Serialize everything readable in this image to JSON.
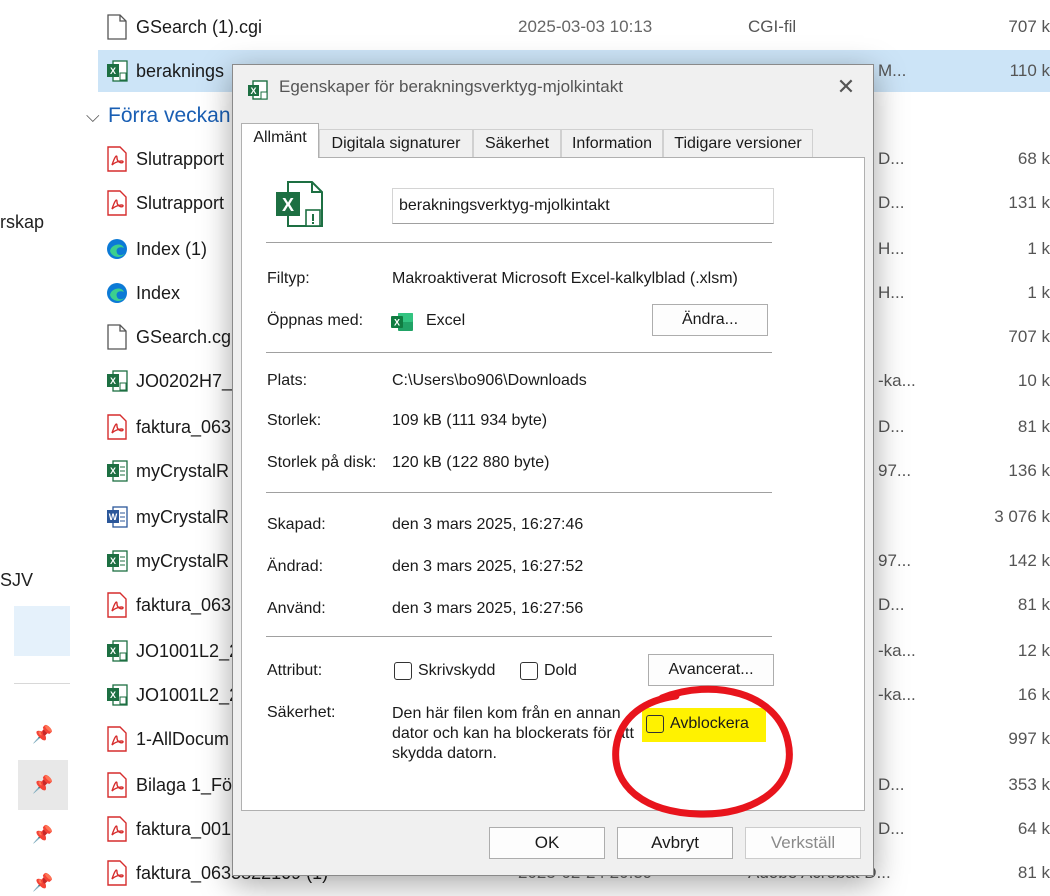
{
  "nav": {
    "label_1": "rskap",
    "label_2": "SJV"
  },
  "files": {
    "group_title": "Förra veckan",
    "rows": [
      {
        "name": "GSearch (1).cgi",
        "date": "2025-03-03 10:13",
        "type": "CGI-fil",
        "size": "707 k",
        "icon": "generic-file-icon"
      },
      {
        "name": "beraknings",
        "type": "M...",
        "size": "110 k",
        "icon": "excel-macro-icon"
      },
      {
        "name": "Slutrapport",
        "type": "D...",
        "size": "68 k",
        "icon": "pdf-icon"
      },
      {
        "name": "Slutrapport",
        "type": "D...",
        "size": "131 k",
        "icon": "pdf-icon"
      },
      {
        "name": "Index (1)",
        "type": "H...",
        "size": "1 k",
        "icon": "edge-icon"
      },
      {
        "name": "Index",
        "type": "H...",
        "size": "1 k",
        "icon": "edge-icon"
      },
      {
        "name": "GSearch.cg",
        "type": "",
        "size": "707 k",
        "icon": "generic-file-icon"
      },
      {
        "name": "JO0202H7_2",
        "type": "-ka...",
        "size": "10 k",
        "icon": "excel-macro-icon"
      },
      {
        "name": "faktura_063",
        "type": "D...",
        "size": "81 k",
        "icon": "pdf-icon"
      },
      {
        "name": "myCrystalR",
        "type": "97...",
        "size": "136 k",
        "icon": "excel-green-icon"
      },
      {
        "name": "myCrystalR",
        "type": "",
        "size": "3 076 k",
        "icon": "word-icon"
      },
      {
        "name": "myCrystalR",
        "type": "97...",
        "size": "142 k",
        "icon": "excel-green-icon"
      },
      {
        "name": "faktura_063",
        "type": "D...",
        "size": "81 k",
        "icon": "pdf-icon"
      },
      {
        "name": "JO1001L2_2",
        "type": "-ka...",
        "size": "12 k",
        "icon": "excel-macro-icon"
      },
      {
        "name": "JO1001L2_2",
        "type": "-ka...",
        "size": "16 k",
        "icon": "excel-macro-icon"
      },
      {
        "name": "1-AllDocum",
        "type": "",
        "size": "997 k",
        "icon": "pdf-icon"
      },
      {
        "name": "Bilaga 1_Fö",
        "type": "D...",
        "size": "353 k",
        "icon": "pdf-icon"
      },
      {
        "name": "faktura_001",
        "type": "D...",
        "size": "64 k",
        "icon": "pdf-icon"
      },
      {
        "name": "faktura_0635822109 (1)",
        "date": "2025-02-24 20:39",
        "type": "Adobe Acrobat D...",
        "size": "81 k",
        "icon": "pdf-icon"
      }
    ]
  },
  "dialog": {
    "title": "Egenskaper för berakningsverktyg-mjolkintakt",
    "tabs": [
      "Allmänt",
      "Digitala signaturer",
      "Säkerhet",
      "Information",
      "Tidigare versioner"
    ],
    "file_name": "berakningsverktyg-mjolkintakt",
    "filetype_label": "Filtyp:",
    "filetype_value": "Makroaktiverat  Microsoft Excel-kalkylblad (.xlsm)",
    "opens_with_label": "Öppnas med:",
    "opens_with_value": "Excel",
    "change_button": "Ändra...",
    "location_label": "Plats:",
    "location_value": "C:\\Users\\bo906\\Downloads",
    "size_label": "Storlek:",
    "size_value": "109 kB (111 934 byte)",
    "disk_size_label": "Storlek på disk:",
    "disk_size_value": "120 kB (122 880 byte)",
    "created_label": "Skapad:",
    "created_value": "den 3 mars 2025, 16:27:46",
    "modified_label": "Ändrad:",
    "modified_value": "den 3 mars 2025, 16:27:52",
    "accessed_label": "Använd:",
    "accessed_value": "den 3 mars 2025, 16:27:56",
    "attributes_label": "Attribut:",
    "readonly_label": "Skrivskydd",
    "hidden_label": "Dold",
    "advanced_button": "Avancerat...",
    "security_label": "Säkerhet:",
    "security_text": "Den här filen kom från en annan dator och kan ha blockerats för att skydda datorn.",
    "unblock_label": "Avblockera",
    "ok_button": "OK",
    "cancel_button": "Avbryt",
    "apply_button": "Verkställ"
  },
  "colors": {
    "highlight": "#fff200",
    "annotation": "#e8141c",
    "selection": "#cce4f7"
  }
}
